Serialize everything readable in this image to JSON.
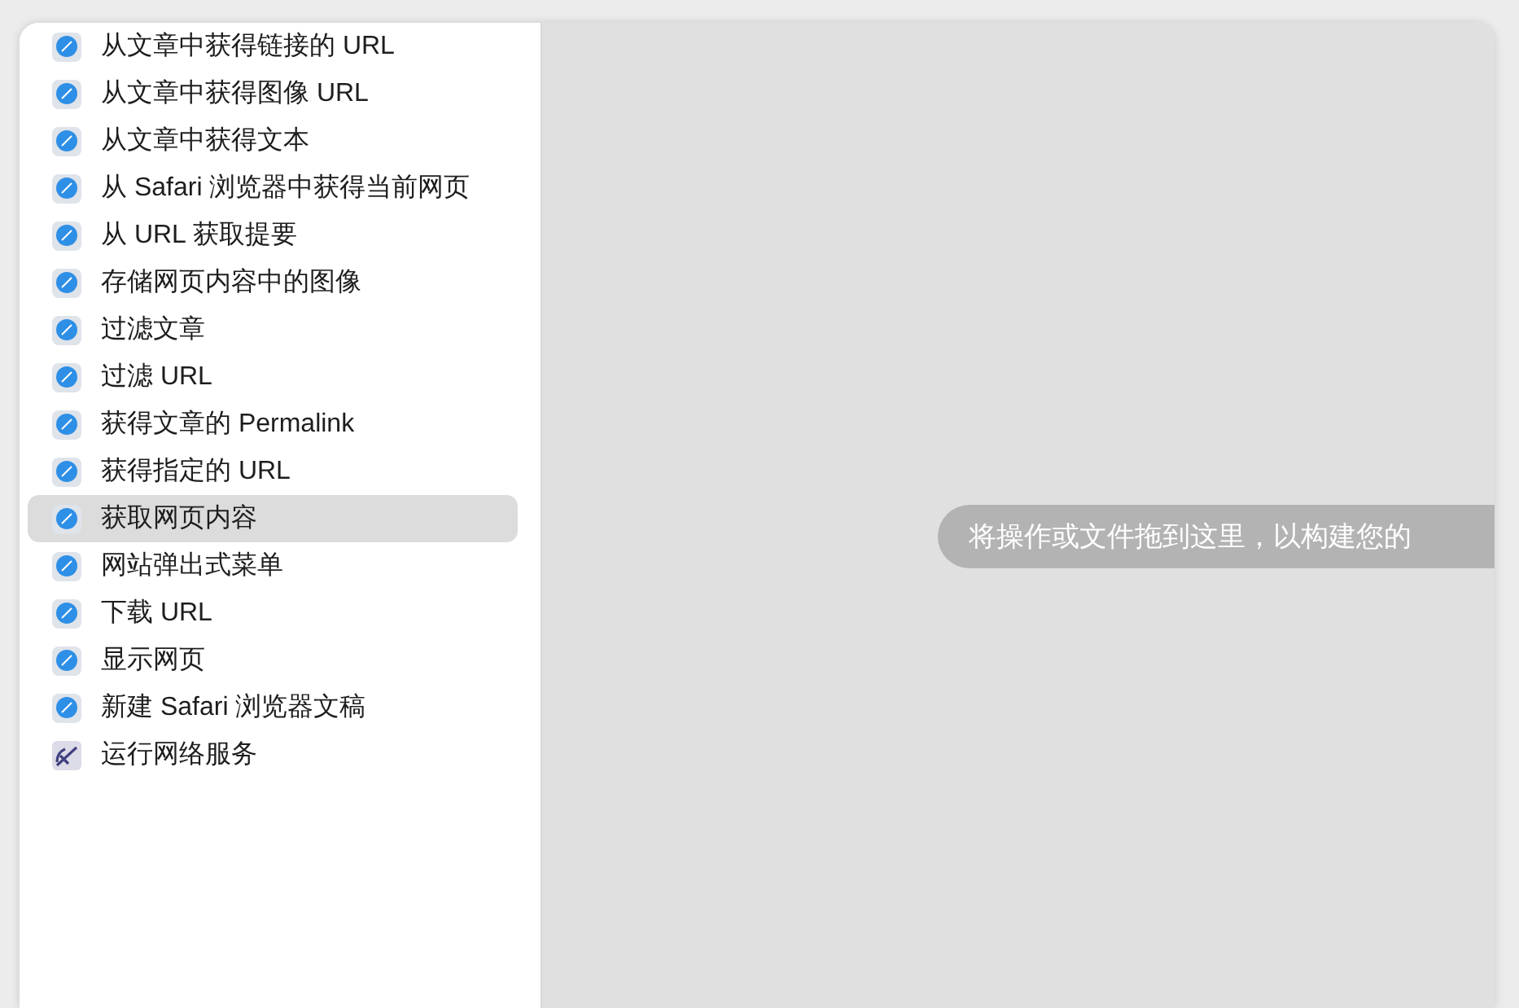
{
  "actions": [
    {
      "label": "从文章中获得链接的 URL",
      "kind": "safari",
      "selected": false
    },
    {
      "label": "从文章中获得图像 URL",
      "kind": "safari",
      "selected": false
    },
    {
      "label": "从文章中获得文本",
      "kind": "safari",
      "selected": false
    },
    {
      "label": "从 Safari 浏览器中获得当前网页",
      "kind": "safari",
      "selected": false
    },
    {
      "label": "从 URL 获取提要",
      "kind": "safari",
      "selected": false
    },
    {
      "label": "存储网页内容中的图像",
      "kind": "safari",
      "selected": false
    },
    {
      "label": "过滤文章",
      "kind": "safari",
      "selected": false
    },
    {
      "label": "过滤 URL",
      "kind": "safari",
      "selected": false
    },
    {
      "label": "获得文章的 Permalink",
      "kind": "safari",
      "selected": false
    },
    {
      "label": "获得指定的 URL",
      "kind": "safari",
      "selected": false
    },
    {
      "label": "获取网页内容",
      "kind": "safari",
      "selected": true
    },
    {
      "label": "网站弹出式菜单",
      "kind": "safari",
      "selected": false
    },
    {
      "label": "下载 URL",
      "kind": "safari",
      "selected": false
    },
    {
      "label": "显示网页",
      "kind": "safari",
      "selected": false
    },
    {
      "label": "新建 Safari 浏览器文稿",
      "kind": "safari",
      "selected": false
    },
    {
      "label": "运行网络服务",
      "kind": "service",
      "selected": false
    }
  ],
  "workflow": {
    "hint": "将操作或文件拖到这里，以构建您的"
  }
}
